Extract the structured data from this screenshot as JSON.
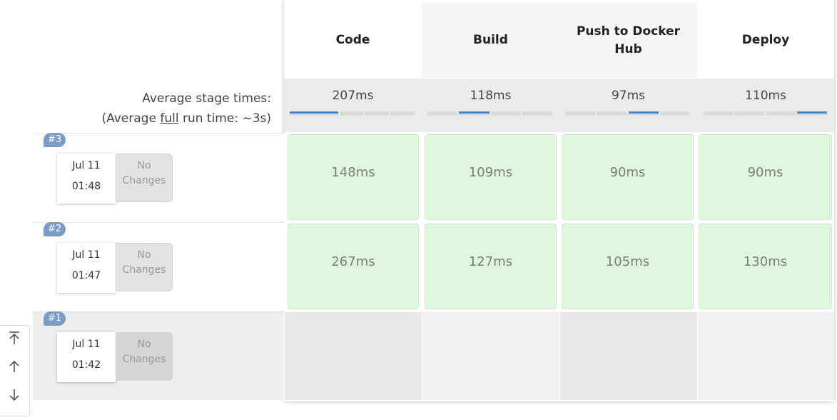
{
  "stages": [
    {
      "label": "Code"
    },
    {
      "label": "Build"
    },
    {
      "label": "Push to Docker Hub"
    },
    {
      "label": "Deploy"
    }
  ],
  "average": {
    "label": "Average stage times:",
    "full_prefix": "(Average ",
    "full_word": "full",
    "full_suffix": " run time: ~3s)",
    "times": [
      "207ms",
      "118ms",
      "97ms",
      "110ms"
    ]
  },
  "builds": [
    {
      "number": "#3",
      "date": "Jul 11",
      "time": "01:48",
      "changes": "No Changes",
      "durations": [
        "148ms",
        "109ms",
        "90ms",
        "90ms"
      ]
    },
    {
      "number": "#2",
      "date": "Jul 11",
      "time": "01:47",
      "changes": "No Changes",
      "durations": [
        "267ms",
        "127ms",
        "105ms",
        "130ms"
      ]
    },
    {
      "number": "#1",
      "date": "Jul 11",
      "time": "01:42",
      "changes": "No Changes",
      "durations": []
    }
  ],
  "icons": {
    "scroll_top": "scroll-to-top-icon",
    "scroll_up": "scroll-up-icon",
    "scroll_down": "scroll-down-icon"
  }
}
